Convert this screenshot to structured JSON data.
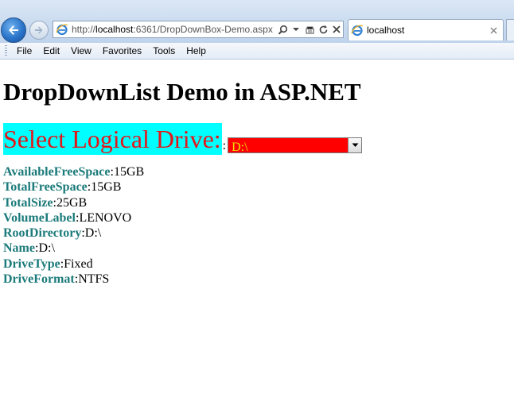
{
  "browser": {
    "url_prefix": "http://",
    "url_host": "localhost",
    "url_rest": ":6361/DropDownBox-Demo.aspx",
    "tab_title": "localhost",
    "menu": [
      "File",
      "Edit",
      "View",
      "Favorites",
      "Tools",
      "Help"
    ],
    "icons": [
      "back-arrow-icon",
      "forward-arrow-icon",
      "ie-icon",
      "search-icon",
      "dropdown-arrow-icon",
      "compatibility-icon",
      "refresh-icon",
      "stop-icon",
      "tab-close-icon"
    ]
  },
  "page": {
    "title": "DropDownList Demo in ASP.NET",
    "select_label": "Select Logical Drive:",
    "select_colon": ":",
    "selected_drive": "D:\\",
    "colors": {
      "label_text": "#e4161a",
      "label_bg": "#00ffff",
      "select_bg": "#ff0000",
      "select_text": "#e8e000",
      "prop_key": "#1b7a7a"
    },
    "properties": [
      {
        "key": "AvailableFreeSpace",
        "value": "15GB"
      },
      {
        "key": "TotalFreeSpace",
        "value": "15GB"
      },
      {
        "key": "TotalSize",
        "value": "25GB"
      },
      {
        "key": "VolumeLabel",
        "value": "LENOVO"
      },
      {
        "key": "RootDirectory",
        "value": "D:\\"
      },
      {
        "key": "Name",
        "value": "D:\\"
      },
      {
        "key": "DriveType",
        "value": "Fixed"
      },
      {
        "key": "DriveFormat",
        "value": "NTFS"
      }
    ],
    "separator": ":"
  }
}
